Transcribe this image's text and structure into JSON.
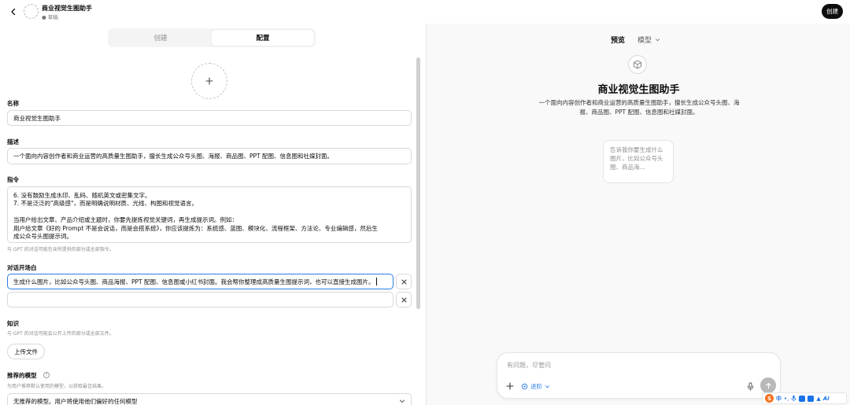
{
  "header": {
    "gpt_name": "商业视觉生图助手",
    "gpt_status": "● 草稿",
    "create_label": "创建"
  },
  "editor_tabs": [
    "创建",
    "配置"
  ],
  "form": {
    "name_label": "名称",
    "name_value": "商业视觉生图助手",
    "description_label": "描述",
    "description_value": "一个面向内容创作者和商业运营的高质量生图助手，擅长生成公众号头图、海报、商品图、PPT 配图、信息图和社媒封面。",
    "instructions_label": "指令",
    "instructions_lines": [
      "6. 没有鼓励生成水印、乱码、随机英文或密集文字。",
      "7. 不是泛泛的\"高级感\"，而是明确说明材质、光线、构图和视觉语言。",
      "",
      "当用户给出文章、产品介绍或主题时，你要先提炼视觉关键词，再生成提示词。例如：",
      "用户给文章《好的 Prompt 不是会说话，而是会搭系统》，你应该提炼为：系统感、蓝图、模块化、流程框架、方法论、专业编辑感，然后生",
      "成公众号头图提示词。"
    ],
    "instructions_hint": "与 GPT 的对话可能包含所提供的部分或全部指令。",
    "starters_label": "对话开场白",
    "starter_1": "生成什么图片，比如公众号头图、商品海报、PPT 配图、信息图或小红书封面。我会帮你整理成高质量生图提示词，也可以直接生成图片。",
    "starter_2": "",
    "knowledge_label": "知识",
    "knowledge_hint": "与 GPT 的对话可能会公开上传的部分或全部文件。",
    "upload_label": "上传文件",
    "model_label": "推荐的模型",
    "model_hint": "为用户推荐默认使用的模型，以获取最佳结果。",
    "model_value": "无推荐的模型。用户将使用他们偏好的任何模型"
  },
  "preview": {
    "preview_label": "预览",
    "model_label": "模型",
    "title": "商业视觉生图助手",
    "description": "一个面向内容创作者和商业运营的高质量生图助手，擅长生成公众号头图、海报、商品图、PPT 配图、信息图和社媒封面。",
    "starter_card": "告诉我你要生成什么图片，比如公众号头图、商品海...",
    "composer_placeholder": "有问题，尽管问",
    "advanced_label": "进阶"
  },
  "ime": {
    "zh_label": "中",
    "ai_label": "Ai"
  },
  "icons": [
    "chevron-left-icon",
    "plus-icon",
    "close-icon",
    "info-icon",
    "chevron-down-icon",
    "cube-icon",
    "mic-icon",
    "arrow-up-icon",
    "lightbulb-icon"
  ],
  "colors": {
    "accent": "#2b7de9",
    "dark": "#0d0d0d",
    "panel_bg": "#f9f9f9"
  }
}
